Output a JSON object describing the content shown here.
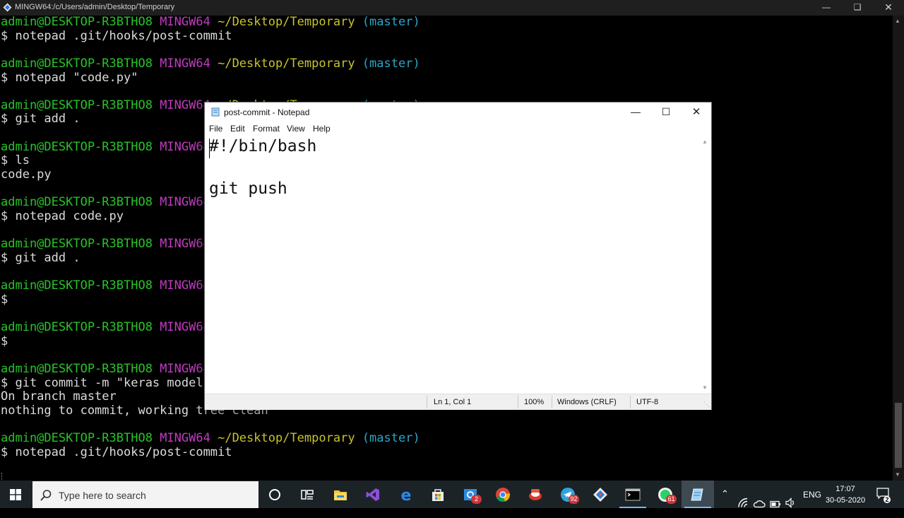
{
  "terminal": {
    "title": "MINGW64:/c/Users/admin/Desktop/Temporary",
    "prompt": {
      "user_host": "admin@DESKTOP-R3BTHO8",
      "env": "MINGW64",
      "path": "~/Desktop/Temporary",
      "branch": "(master)"
    },
    "commands": [
      {
        "cmd": "$ notepad .git/hooks/post-commit",
        "output": []
      },
      {
        "cmd": "$ notepad \"code.py\"",
        "output": []
      },
      {
        "cmd": "$ git add .",
        "output": []
      },
      {
        "cmd": "$ ls",
        "output": [
          "code.py"
        ]
      },
      {
        "cmd": "$ notepad code.py",
        "output": []
      },
      {
        "cmd": "$ git add .",
        "output": []
      },
      {
        "cmd": "$",
        "output": []
      },
      {
        "cmd": "$",
        "output": []
      },
      {
        "cmd": "$ git commit -m \"keras model",
        "output": [
          "On branch master",
          "nothing to commit, working tree clean"
        ]
      },
      {
        "cmd": "$ notepad .git/hooks/post-commit",
        "output": []
      }
    ]
  },
  "notepad": {
    "title": "post-commit - Notepad",
    "menu": [
      "File",
      "Edit",
      "Format",
      "View",
      "Help"
    ],
    "content_lines": [
      "#!/bin/bash",
      "",
      "git push"
    ],
    "status": {
      "position": "Ln 1, Col 1",
      "zoom": "100%",
      "line_ending": "Windows (CRLF)",
      "encoding": "UTF-8"
    }
  },
  "taskbar": {
    "search_placeholder": "Type here to search",
    "apps": [
      {
        "name": "cortana",
        "badge": ""
      },
      {
        "name": "task-view",
        "badge": ""
      },
      {
        "name": "file-explorer",
        "badge": ""
      },
      {
        "name": "visual-studio",
        "badge": ""
      },
      {
        "name": "edge",
        "badge": ""
      },
      {
        "name": "store",
        "badge": ""
      },
      {
        "name": "mail",
        "badge": "2"
      },
      {
        "name": "chrome",
        "badge": ""
      },
      {
        "name": "red-app",
        "badge": ""
      },
      {
        "name": "telegram",
        "badge": "92"
      },
      {
        "name": "git",
        "badge": ""
      },
      {
        "name": "terminal",
        "badge": ""
      },
      {
        "name": "whatsapp",
        "badge": "61"
      },
      {
        "name": "notepad",
        "badge": ""
      }
    ],
    "language": "ENG",
    "time": "17:07",
    "date": "30-05-2020",
    "notifications": "2"
  }
}
